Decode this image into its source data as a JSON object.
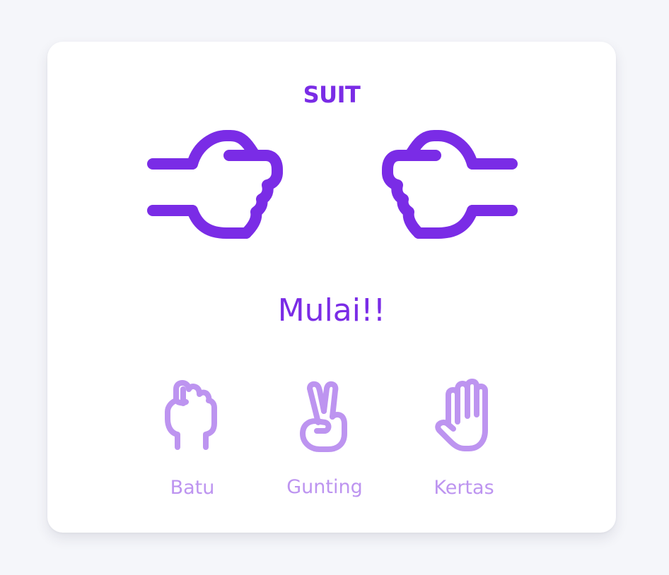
{
  "game": {
    "title": "SUIT",
    "status": "Mulai!!"
  },
  "colors": {
    "primary": "#7a2ce6",
    "choice": "#bd94f0",
    "card_background": "#ffffff",
    "page_background": "#f5f6fa"
  },
  "hands": {
    "player_icon": "pointing-hand-right-icon",
    "opponent_icon": "pointing-hand-left-icon"
  },
  "choices": [
    {
      "label": "Batu",
      "icon": "fist-icon"
    },
    {
      "label": "Gunting",
      "icon": "victory-hand-icon"
    },
    {
      "label": "Kertas",
      "icon": "open-palm-icon"
    }
  ]
}
